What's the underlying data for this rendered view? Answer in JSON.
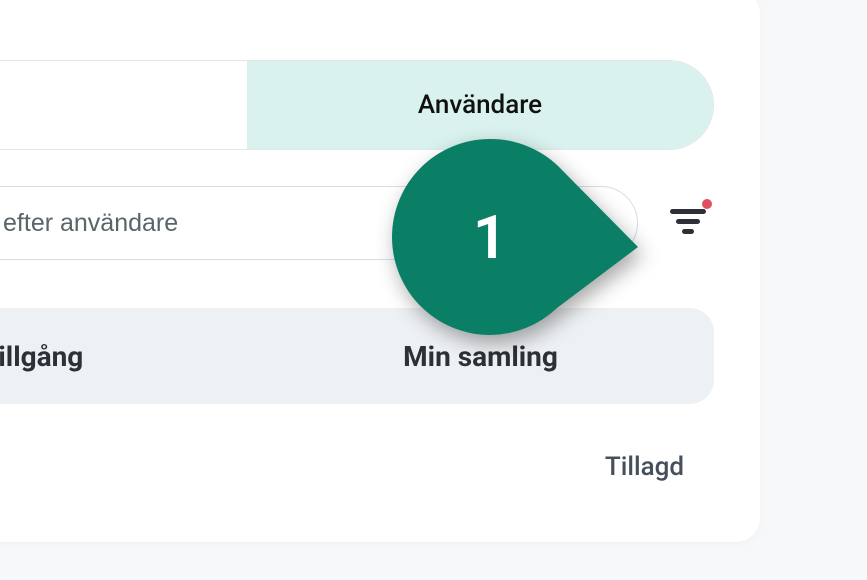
{
  "tabs": {
    "active_label": "Användare"
  },
  "search": {
    "placeholder": "Sök efter användare"
  },
  "segments": {
    "left_label_partial": "enstillgång",
    "right_label": "Min samling"
  },
  "column": {
    "added_label": "Tillagd"
  },
  "marker": {
    "step": "1"
  },
  "colors": {
    "accent_teal": "#10aea8",
    "marker_green": "#0b7f66",
    "filter_dot": "#e0515d",
    "tab_active_bg": "#d9f2ee"
  }
}
